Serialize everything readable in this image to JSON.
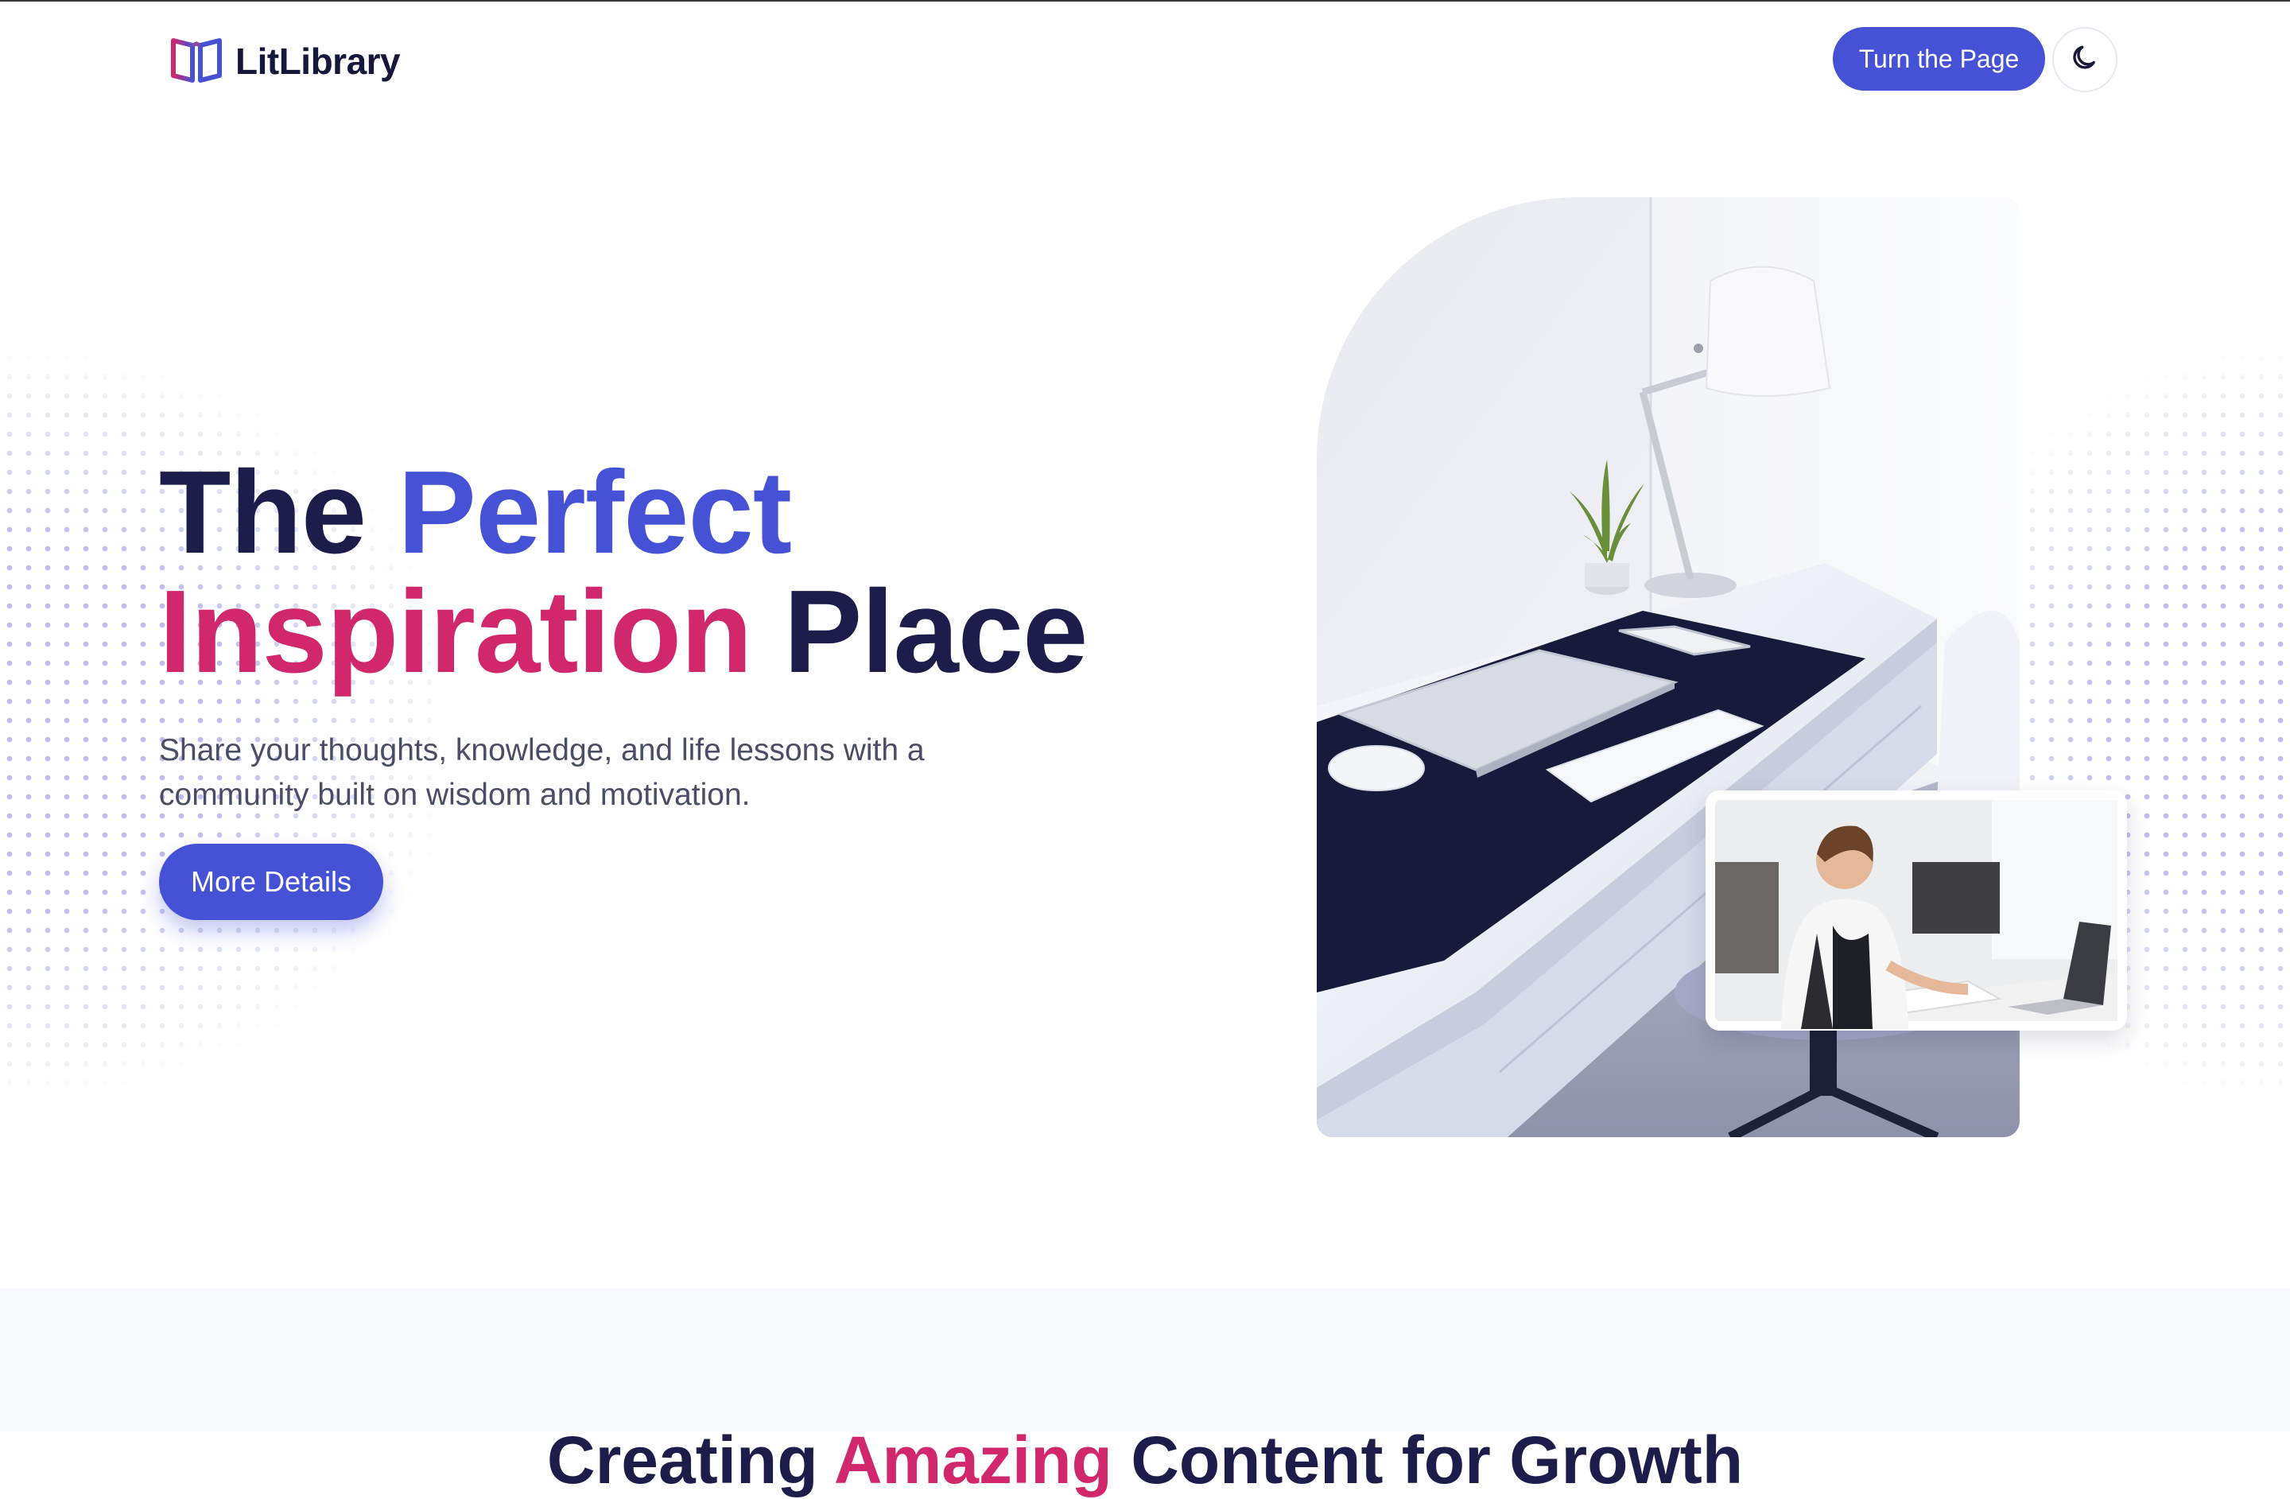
{
  "brand": {
    "name": "LitLibrary",
    "logo_icon": "open-book-icon"
  },
  "header": {
    "cta_label": "Turn the Page",
    "theme_toggle_icon": "moon-icon"
  },
  "hero": {
    "title_part1": "The ",
    "title_part2": "Perfect",
    "title_part3": "Inspiration",
    "title_part4": " Place",
    "subtitle": "Share your thoughts, knowledge, and life lessons with a community built on wisdom and motivation.",
    "button_label": "More Details"
  },
  "images": {
    "main": "workspace-desk-photo",
    "inset": "woman-working-laptop-photo"
  },
  "section": {
    "title_start": "Creating ",
    "title_accent": "Amazing",
    "title_end": " Content for Growth"
  },
  "colors": {
    "primary": "#4652d6",
    "accent_pink": "#d0276d",
    "heading": "#1c1d4a",
    "body_text": "#4a4d66",
    "section_bg": "#f7f8fc"
  }
}
